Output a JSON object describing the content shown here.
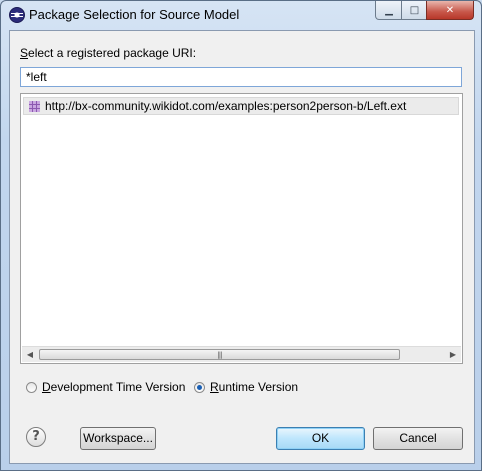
{
  "window": {
    "title": "Package Selection for Source Model",
    "minimize_glyph": "▁",
    "maximize_glyph": "□",
    "close_glyph": "✕"
  },
  "dialog": {
    "uri_label_accel": "S",
    "uri_label_rest": "elect a registered package URI:",
    "filter_value": "*left",
    "list_items": [
      {
        "icon": "package-icon",
        "text": "http://bx-community.wikidot.com/examples:person2person-b/Left.ext"
      }
    ],
    "scroll_left_glyph": "◀",
    "scroll_right_glyph": "▶",
    "scroll_thumb_grip": "|||",
    "radio_dev_accel": "D",
    "radio_dev_rest": "evelopment Time Version",
    "radio_dev_checked": false,
    "radio_rt_accel": "R",
    "radio_rt_rest": "untime Version",
    "radio_rt_checked": true,
    "help_glyph": "?",
    "workspace_label": "Workspace...",
    "ok_label": "OK",
    "cancel_label": "Cancel"
  },
  "colors": {
    "titlebar": "#c9daee",
    "client": "#f0f0f0",
    "selection": "#ebebeb",
    "package_icon": "#8c58b0"
  }
}
